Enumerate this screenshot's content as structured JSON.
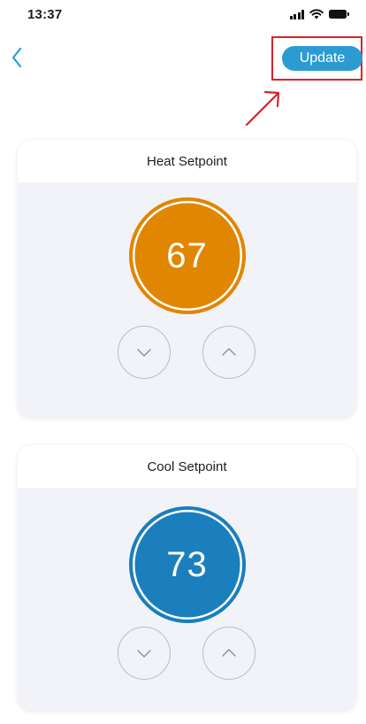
{
  "status_bar": {
    "time": "13:37"
  },
  "header": {
    "update_label": "Update"
  },
  "heat_card": {
    "title": "Heat Setpoint",
    "value": "67",
    "color": "#e08600"
  },
  "cool_card": {
    "title": "Cool Setpoint",
    "value": "73",
    "color": "#1a7fbc"
  },
  "colors": {
    "accent": "#2b9bd2",
    "highlight_box": "#d8232a",
    "card_background": "#f2f3f8"
  },
  "icons": [
    "back-chevron-icon",
    "signal-icon",
    "wifi-icon",
    "battery-icon",
    "chevron-down-icon",
    "chevron-up-icon",
    "annotation-arrow-icon"
  ]
}
